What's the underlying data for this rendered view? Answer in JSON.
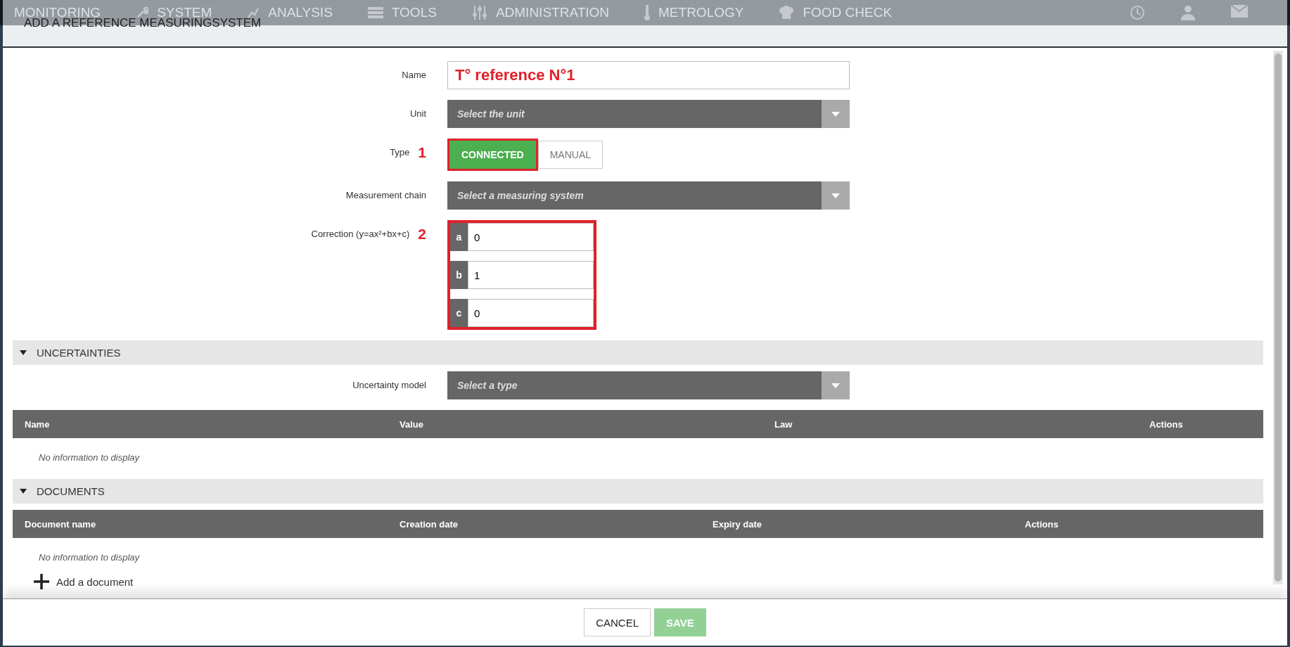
{
  "nav": {
    "items": [
      {
        "label": "MONITORING"
      },
      {
        "label": "SYSTEM"
      },
      {
        "label": "ANALYSIS"
      },
      {
        "label": "TOOLS"
      },
      {
        "label": "ADMINISTRATION"
      },
      {
        "label": "METROLOGY"
      },
      {
        "label": "FOOD CHECK"
      }
    ]
  },
  "dialog": {
    "title": "ADD A REFERENCE MEASURINGSYSTEM",
    "fields": [
      {
        "kind": "text",
        "label": "Name",
        "value": "T° reference N°1"
      },
      {
        "kind": "select",
        "label": "Unit",
        "placeholder": "Select the unit"
      },
      {
        "kind": "toggle",
        "label": "Type",
        "annotation": "1",
        "options": [
          {
            "label": "CONNECTED",
            "selected": true
          },
          {
            "label": "MANUAL",
            "selected": false
          }
        ]
      },
      {
        "kind": "select",
        "label": "Measurement chain",
        "placeholder": "Select a measuring system"
      },
      {
        "kind": "coefficients",
        "label": "Correction (y=ax²+bx+c)",
        "annotation": "2",
        "coefficients": [
          {
            "name": "a",
            "value": "0"
          },
          {
            "name": "b",
            "value": "1"
          },
          {
            "name": "c",
            "value": "0"
          }
        ]
      }
    ],
    "sections": [
      {
        "title": "UNCERTAINTIES",
        "expanded": true,
        "fields": [
          {
            "kind": "select",
            "label": "Uncertainty model",
            "placeholder": "Select a type"
          }
        ],
        "table": {
          "columns": [
            "Name",
            "Value",
            "Law",
            "Actions"
          ],
          "empty_text": "No information to display"
        }
      },
      {
        "title": "DOCUMENTS",
        "expanded": true,
        "table": {
          "columns": [
            "Document name",
            "Creation date",
            "Expiry date",
            "Actions"
          ],
          "empty_text": "No information to display"
        },
        "add_link": "Add a document"
      }
    ],
    "buttons": [
      {
        "label": "CANCEL",
        "kind": "secondary",
        "disabled": false
      },
      {
        "label": "SAVE",
        "kind": "primary",
        "disabled": true
      }
    ]
  }
}
